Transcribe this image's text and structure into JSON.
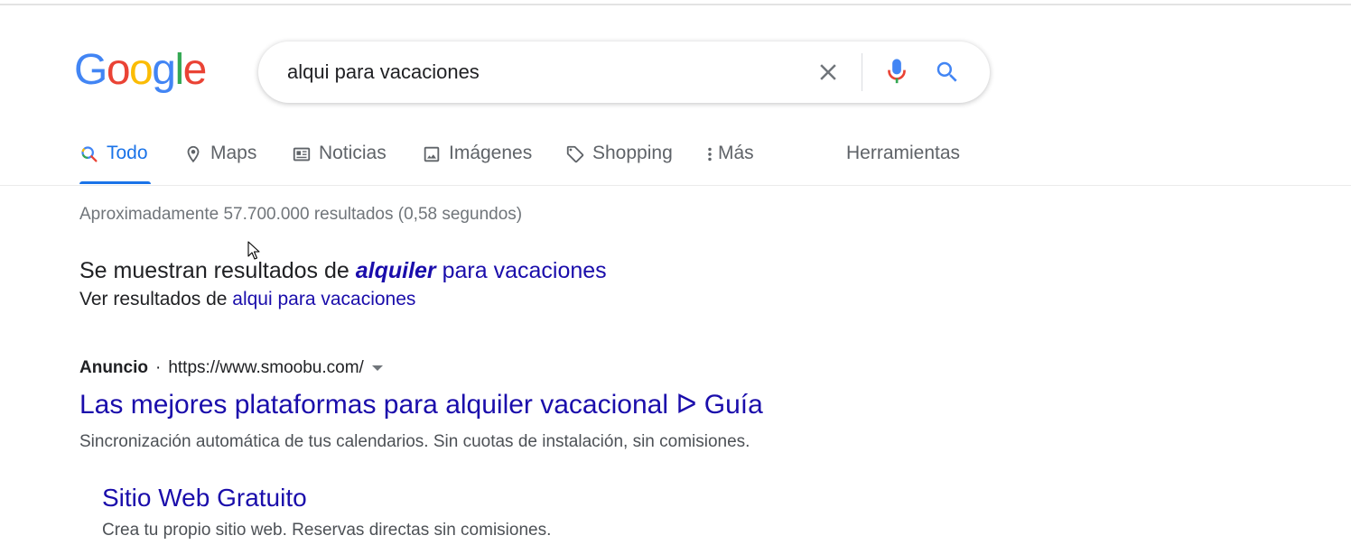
{
  "logo": {
    "letters": [
      "G",
      "o",
      "o",
      "g",
      "l",
      "e"
    ],
    "colors": [
      "#4285f4",
      "#ea4335",
      "#fbbc05",
      "#4285f4",
      "#34a853",
      "#ea4335"
    ]
  },
  "search": {
    "query": "alqui para vacaciones"
  },
  "tabs": [
    {
      "label": "Todo",
      "icon": "search-icon",
      "active": true
    },
    {
      "label": "Maps",
      "icon": "map-pin-icon"
    },
    {
      "label": "Noticias",
      "icon": "news-icon"
    },
    {
      "label": "Imágenes",
      "icon": "image-icon"
    },
    {
      "label": "Shopping",
      "icon": "tag-icon"
    },
    {
      "label": "Más",
      "icon": "more-vertical-icon"
    }
  ],
  "tools_label": "Herramientas",
  "stats": "Aproximadamente 57.700.000 resultados (0,58 segundos)",
  "correction": {
    "prefix": "Se muestran resultados de ",
    "corrected_bold": "alquiler",
    "corrected_rest": " para vacaciones",
    "see_prefix": "Ver resultados de ",
    "original_query": "alqui para vacaciones"
  },
  "ad": {
    "label": "Anuncio",
    "separator": "·",
    "url": "https://www.smoobu.com/",
    "title": "Las mejores plataformas para alquiler vacacional ᐅ Guía",
    "description": "Sincronización automática de tus calendarios. Sin cuotas de instalación, sin comisiones.",
    "sitelink": {
      "title": "Sitio Web Gratuito",
      "description": "Crea tu propio sitio web. Reservas directas sin comisiones."
    }
  },
  "colors": {
    "link": "#1a0dab",
    "accent": "#1a73e8",
    "muted": "#70757a"
  }
}
